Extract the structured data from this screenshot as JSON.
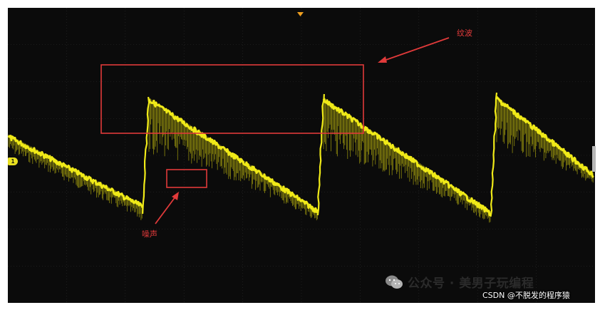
{
  "annotations": {
    "ripple_label": "纹波",
    "noise_label": "噪声"
  },
  "channel_marker": "1",
  "watermark": {
    "text": "公众号 · 美男子玩编程",
    "icon": "wechat-icon"
  },
  "credit": "CSDN @不脱发的程序猿",
  "colors": {
    "screen": "#0b0b0b",
    "grid": "#2c2c2c",
    "trace": "#f0ea18",
    "trace_dim": "#8f8a0e",
    "annotation": "#e03a3a",
    "trigger": "#f0a020"
  }
}
